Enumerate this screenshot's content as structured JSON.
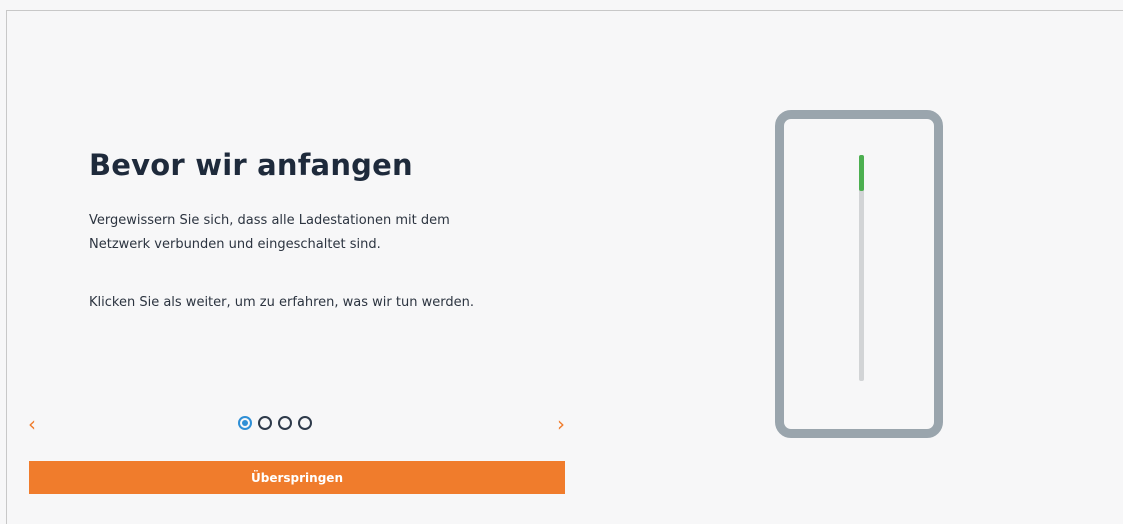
{
  "page": {
    "title": "Bevor wir anfangen",
    "paragraph1": "Vergewissern Sie sich, dass alle Ladestationen mit dem Netzwerk verbunden und eingeschaltet sind.",
    "paragraph2": "Klicken Sie als weiter, um zu erfahren, was wir tun werden."
  },
  "carousel": {
    "prev_icon": "‹",
    "next_icon": "›",
    "pages_total": 4,
    "current_page": 1
  },
  "skip_button": {
    "label": "Überspringen"
  },
  "illustration": {
    "progress_fraction": 0.16
  },
  "colors": {
    "accent": "#f07c2c",
    "active_dot": "#2e8fd6",
    "progress_green": "#4caf50",
    "phone_frame": "#9aa5ad"
  }
}
